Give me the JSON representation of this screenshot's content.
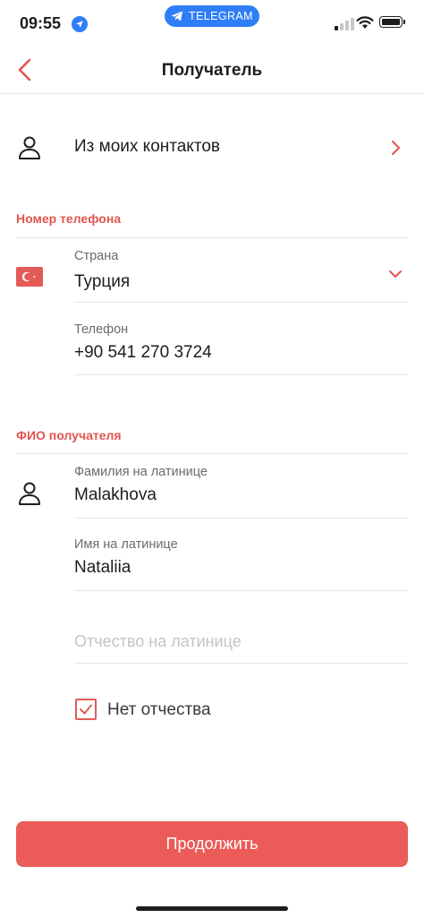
{
  "status_bar": {
    "time": "09:55",
    "back_app": "TELEGRAM"
  },
  "header": {
    "title": "Получатель"
  },
  "contacts": {
    "label": "Из моих контактов"
  },
  "phone_section": {
    "title": "Номер телефона",
    "country_label": "Страна",
    "country_value": "Турция",
    "phone_label": "Телефон",
    "phone_value": "+90 541 270 3724"
  },
  "name_section": {
    "title": "ФИО получателя",
    "last_name_label": "Фамилия на латинице",
    "last_name_value": "Malakhova",
    "first_name_label": "Имя на латинице",
    "first_name_value": "Nataliia",
    "patronymic_placeholder": "Отчество на латинице",
    "no_patronymic_label": "Нет отчества",
    "no_patronymic_checked": true
  },
  "footer": {
    "continue_label": "Продолжить"
  },
  "colors": {
    "accent": "#eb5c59",
    "telegram": "#2f7ef7"
  }
}
